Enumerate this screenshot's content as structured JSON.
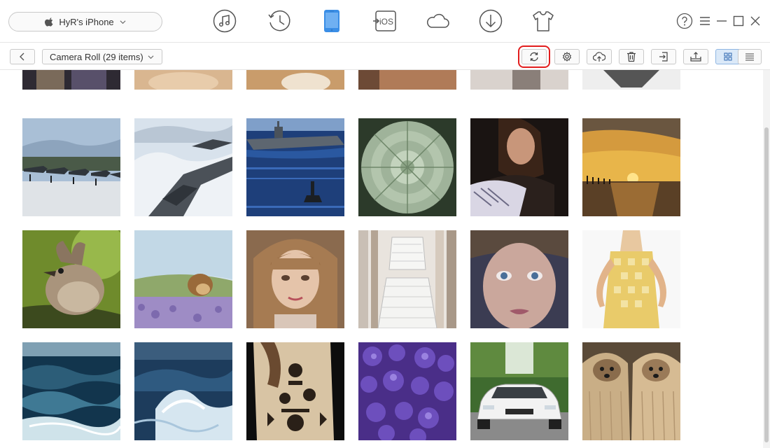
{
  "device": {
    "name": "HyR's iPhone",
    "icon": "apple-icon"
  },
  "nav": [
    {
      "name": "music-icon",
      "label": "Music"
    },
    {
      "name": "history-icon",
      "label": "History"
    },
    {
      "name": "iphone-icon",
      "label": "Device",
      "active": true
    },
    {
      "name": "ios-mover-icon",
      "label": "iOS"
    },
    {
      "name": "cloud-icon",
      "label": "iCloud"
    },
    {
      "name": "download-icon",
      "label": "Download"
    },
    {
      "name": "tshirt-icon",
      "label": "Skin"
    }
  ],
  "window_controls": [
    "help-icon",
    "menu-icon",
    "minimize-icon",
    "maximize-icon",
    "close-icon"
  ],
  "toolbar": {
    "album_label": "Camera Roll (29 items)",
    "buttons": [
      "refresh-icon",
      "settings-icon",
      "upload-icon",
      "delete-icon",
      "export-icon",
      "to-computer-icon",
      "grid-view-icon",
      "list-view-icon"
    ],
    "highlighted_button": "refresh-icon",
    "active_view": "grid-view-icon"
  },
  "photos": [
    [
      "partial-photo",
      "partial-photo",
      "partial-photo",
      "partial-photo",
      "partial-photo",
      "partial-photo"
    ],
    [
      "fighter-jets-snow",
      "jet-over-clouds",
      "aircraft-carrier",
      "succulent",
      "woman-portrait",
      "sunset-pier"
    ],
    [
      "bird",
      "hedgehog-lavender",
      "woman-bangs",
      "white-outfit",
      "blue-eyes-face",
      "yellow-dress"
    ],
    [
      "ocean-waves",
      "stormy-sea",
      "tattooed-back",
      "purple-hyacinths",
      "white-car",
      "yorkshire-dogs"
    ]
  ],
  "colors": {
    "accent": "#3a8ee6",
    "highlight": "#e21d1d"
  }
}
